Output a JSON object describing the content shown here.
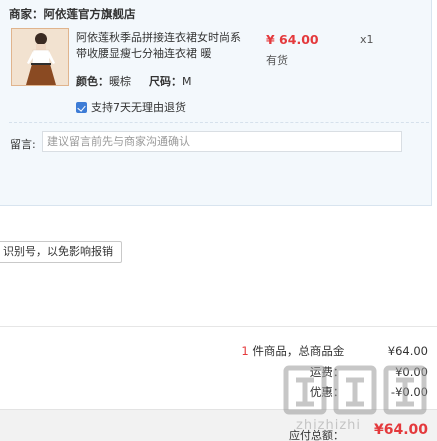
{
  "store": {
    "label": "商家：",
    "name": "阿依莲官方旗舰店"
  },
  "product": {
    "title": "阿依莲秋季品拼接连衣裙女时尚系带收腰显瘦七分袖连衣裙 暖",
    "price": "¥ 64.00",
    "stock": "有货",
    "quantity": "x1",
    "color_label": "颜色：",
    "color_value": "暖棕",
    "size_label": "尺码：",
    "size_value": "M",
    "return_policy": "支持7天无理由退货",
    "return_icon": "check-badge-icon"
  },
  "message": {
    "label": "留言:",
    "placeholder": "建议留言前先与商家沟通确认"
  },
  "invoice_tip": "识别号，以免影响报销",
  "summary": {
    "count": "1",
    "count_suffix": "件商品，总商品金",
    "goods_amount": "¥64.00",
    "row2_label": "运费：",
    "row2_amount": "¥0.00",
    "row3_label": "优惠：",
    "row3_amount": "-¥0.00",
    "total_label": "应付总额：",
    "total_amount": "¥64.00"
  },
  "watermark": {
    "text": "zhizhizhi",
    "glyph_icon": "zhi-watermark-icon"
  },
  "colors": {
    "accent_red": "#e4393c",
    "panel_bg": "#f3f8fc",
    "link_blue": "#3d7cd6"
  }
}
